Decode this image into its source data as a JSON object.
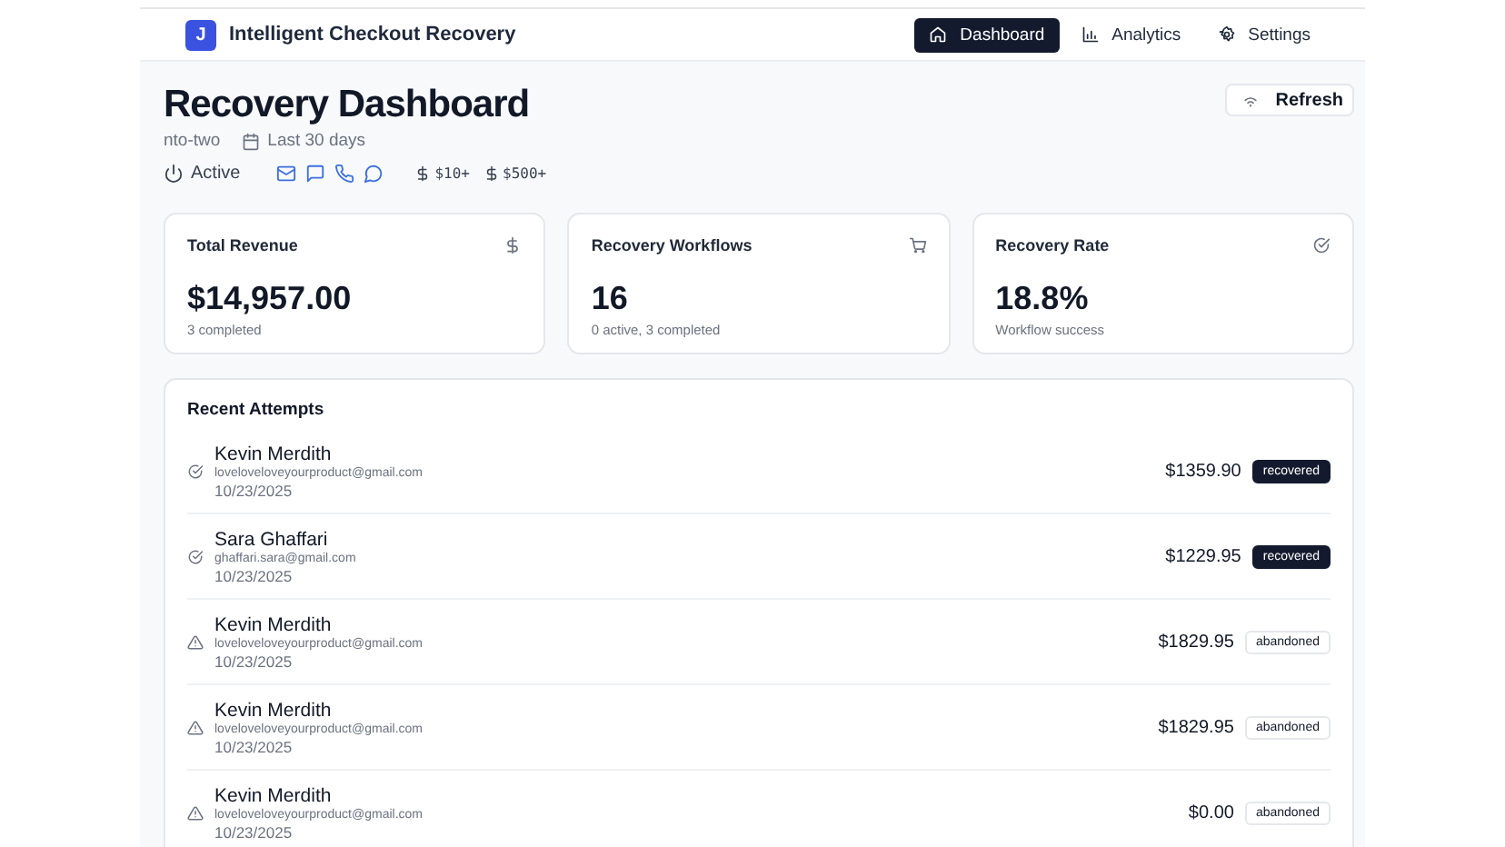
{
  "app": {
    "logo": "J",
    "title": "Intelligent Checkout Recovery"
  },
  "nav": [
    {
      "label": "Dashboard",
      "selected": true
    },
    {
      "label": "Analytics",
      "selected": false
    },
    {
      "label": "Settings",
      "selected": false
    }
  ],
  "page": {
    "title": "Recovery Dashboard",
    "store": "nto-two",
    "range": "Last 30 days",
    "status": "Active",
    "filters": [
      "$10+",
      "$500+"
    ],
    "refresh": "Refresh"
  },
  "stats": [
    {
      "title": "Total Revenue",
      "value": "$14,957.00",
      "note": "3 completed"
    },
    {
      "title": "Recovery Workflows",
      "value": "16",
      "note": "0 active, 3 completed"
    },
    {
      "title": "Recovery Rate",
      "value": "18.8%",
      "note": "Workflow success"
    }
  ],
  "attempts": {
    "title": "Recent Attempts",
    "rows": [
      {
        "name": "Kevin Merdith",
        "email": "loveloveloveyourproduct@gmail.com",
        "date": "10/23/2025",
        "amount": "$1359.90",
        "status": "recovered",
        "kind": "recovered"
      },
      {
        "name": "Sara Ghaffari",
        "email": "ghaffari.sara@gmail.com",
        "date": "10/23/2025",
        "amount": "$1229.95",
        "status": "recovered",
        "kind": "recovered"
      },
      {
        "name": "Kevin Merdith",
        "email": "loveloveloveyourproduct@gmail.com",
        "date": "10/23/2025",
        "amount": "$1829.95",
        "status": "abandoned",
        "kind": "abandoned"
      },
      {
        "name": "Kevin Merdith",
        "email": "loveloveloveyourproduct@gmail.com",
        "date": "10/23/2025",
        "amount": "$1829.95",
        "status": "abandoned",
        "kind": "abandoned"
      },
      {
        "name": "Kevin Merdith",
        "email": "loveloveloveyourproduct@gmail.com",
        "date": "10/23/2025",
        "amount": "$0.00",
        "status": "abandoned",
        "kind": "abandoned"
      }
    ]
  }
}
